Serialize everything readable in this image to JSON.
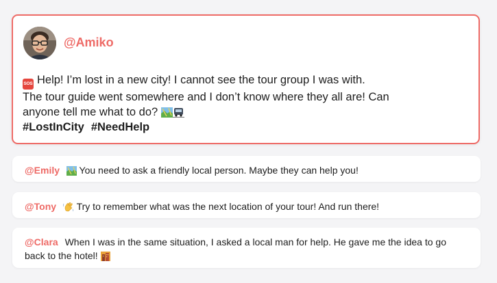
{
  "post": {
    "username": "@Amiko",
    "lines": [
      "Help! I’m lost in a new city! I cannot see the tour group I was with.",
      "The tour guide went somewhere and I don’t know where they all are! Can",
      "anyone tell me what to do?"
    ],
    "hashtags": [
      "#LostInCity",
      "#NeedHelp"
    ],
    "sos_icon_text": "SOS",
    "icons": [
      "sos-icon",
      "map-icon",
      "train-icon"
    ]
  },
  "replies": [
    {
      "username": "@Emily",
      "text": "You need to ask a friendly local person. Maybe they can help you!",
      "icon": "map-icon"
    },
    {
      "username": "@Tony",
      "text": "Try to remember what was the next location of your tour! And run there!",
      "icon": "waving-hand-icon"
    },
    {
      "username": "@Clara",
      "text": "When I was in the same situation, I asked a local man for help. He gave me the idea to go back to the hotel!",
      "icon": "hotel-icon"
    }
  ],
  "colors": {
    "accent": "#ee6a66",
    "background": "#f4f4f6",
    "card": "#ffffff",
    "text": "#1c1c1c"
  }
}
